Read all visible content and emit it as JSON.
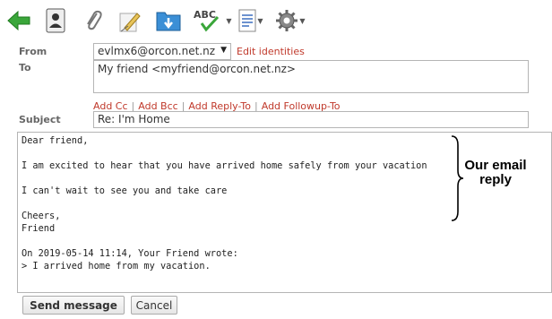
{
  "toolbar": {
    "icons": [
      "back-arrow-icon",
      "addressbook-icon",
      "attachment-icon",
      "signature-icon",
      "save-icon",
      "spellcheck-icon",
      "list-icon",
      "gear-icon"
    ],
    "spell_label": "ABC"
  },
  "from": {
    "label": "From",
    "value": "evlmx6@orcon.net.nz",
    "edit_identities": "Edit identities"
  },
  "to": {
    "label": "To",
    "value": "My friend <myfriend@orcon.net.nz>"
  },
  "add_links": [
    "Add Cc",
    "Add Bcc",
    "Add Reply-To",
    "Add Followup-To"
  ],
  "subject": {
    "label": "Subject",
    "value": "Re: I'm Home"
  },
  "message_body": "Dear friend,\n\nI am excited to hear that you have arrived home safely from your vacation\n\nI can't wait to see you and take care\n\nCheers,\nFriend\n\nOn 2019-05-14 11:14, Your Friend wrote:\n> I arrived home from my vacation.",
  "annotation": "Our email reply",
  "buttons": {
    "send": "Send message",
    "cancel": "Cancel"
  },
  "colors": {
    "accent": "#c0392b",
    "arrow_green": "#2e9e2e"
  }
}
